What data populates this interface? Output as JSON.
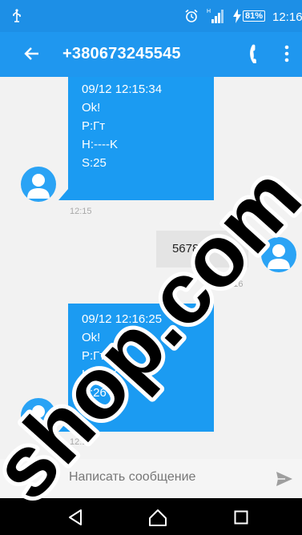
{
  "status_bar": {
    "battery": "81%",
    "time": "12:16"
  },
  "app_bar": {
    "title": "+380673245545"
  },
  "messages": [
    {
      "direction": "incoming",
      "lines": [
        "09/12 12:15:34",
        "Ok!",
        "P:Гт",
        "H:----K",
        "S:25"
      ],
      "time": "12:15"
    },
    {
      "direction": "outgoing",
      "text": "567890 9 1",
      "time": "12:16"
    },
    {
      "direction": "incoming",
      "lines": [
        "09/12 12:16:25",
        "Ok!",
        "P:Гт",
        "H:----K",
        "S:26"
      ],
      "time": "12:16"
    }
  ],
  "composer": {
    "placeholder": "Написать сообщение"
  },
  "watermark": {
    "text": "shop.com"
  },
  "colors": {
    "status_bar": "#1d8fe6",
    "app_bar": "#1f97ef",
    "incoming_bubble": "#1b9bf2",
    "outgoing_bubble": "#e4e4e4",
    "chat_background": "#f2f2f2",
    "watermark": "#000000"
  }
}
